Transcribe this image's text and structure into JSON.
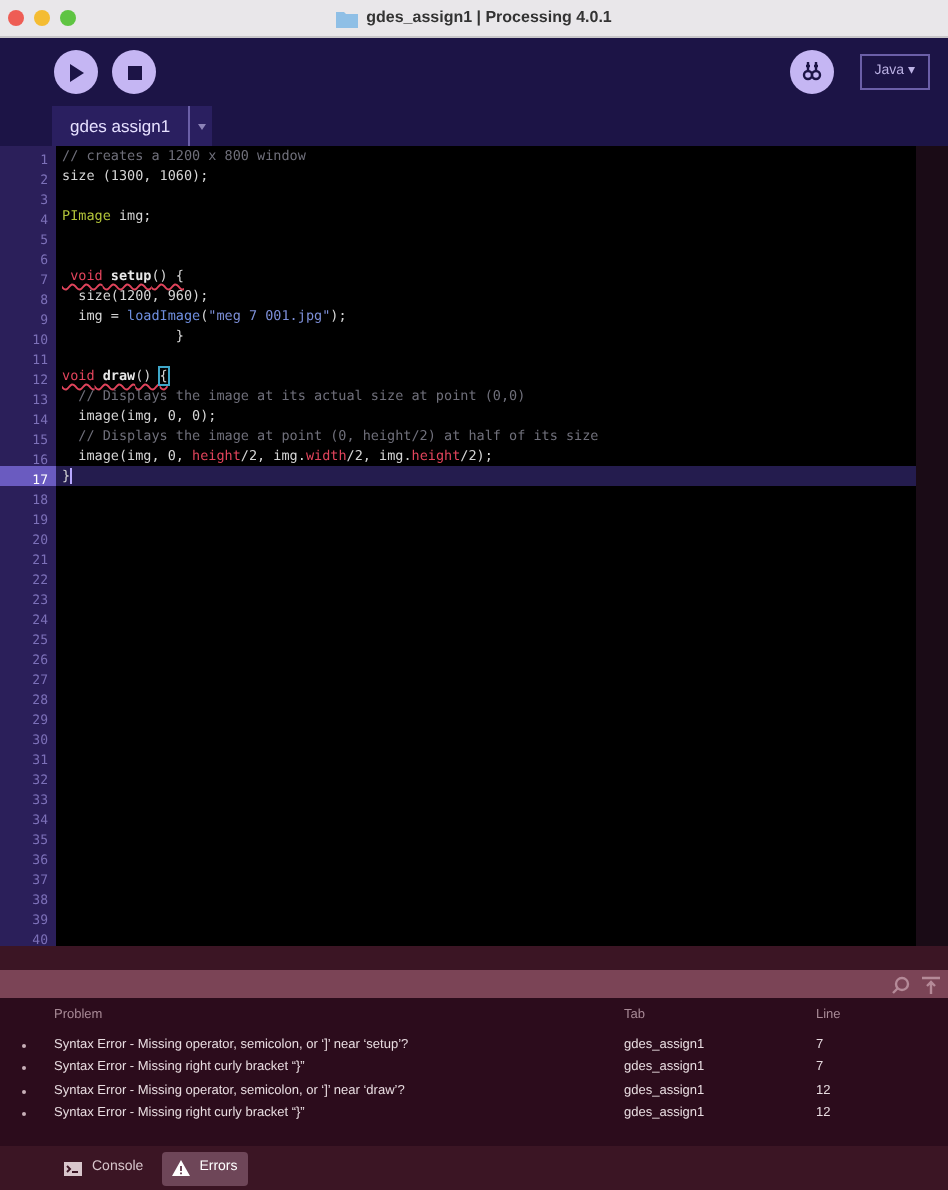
{
  "window": {
    "title": "gdes_assign1 | Processing 4.0.1"
  },
  "toolbar": {
    "mode": "Java ▾"
  },
  "tabs": [
    {
      "label": "gdes assign1",
      "selected": true
    }
  ],
  "editor": {
    "lines": [
      {
        "number": "1",
        "current": false,
        "tokens": [
          {
            "kind": "comment",
            "text": "// creates a 1200 x 800 window"
          }
        ]
      },
      {
        "number": "2",
        "current": false,
        "tokens": [
          {
            "kind": "plain",
            "text": "size (1300, 1060);"
          }
        ]
      },
      {
        "number": "3",
        "current": false
      },
      {
        "number": "4",
        "current": false,
        "tokens": [
          {
            "kind": "type",
            "text": "PImage"
          },
          {
            "kind": "plain",
            "text": " img;"
          }
        ]
      },
      {
        "number": "5",
        "current": false
      },
      {
        "number": "6",
        "current": false
      },
      {
        "number": "7",
        "current": false,
        "tokens": [
          {
            "kind": "keyword",
            "text": " void",
            "error": true
          },
          {
            "kind": "function",
            "text": " setup",
            "error": true
          },
          {
            "kind": "plain",
            "text": "() {",
            "error": true
          }
        ]
      },
      {
        "number": "8",
        "current": false,
        "tokens": [
          {
            "kind": "plain",
            "text": "  size(1200, 960);"
          }
        ]
      },
      {
        "number": "9",
        "current": false,
        "tokens": [
          {
            "kind": "plain",
            "text": "  img = "
          },
          {
            "kind": "builtin",
            "text": "loadImage"
          },
          {
            "kind": "plain",
            "text": "("
          },
          {
            "kind": "string",
            "text": "\"meg 7 001.jpg\""
          },
          {
            "kind": "plain",
            "text": ");"
          }
        ]
      },
      {
        "number": "10",
        "current": false,
        "tokens": [
          {
            "kind": "plain",
            "text": "              }"
          }
        ]
      },
      {
        "number": "11",
        "current": false
      },
      {
        "number": "12",
        "current": false,
        "tokens": [
          {
            "kind": "keyword",
            "text": "void",
            "error": true
          },
          {
            "kind": "function",
            "text": " draw",
            "error": true
          },
          {
            "kind": "plain",
            "text": "() ",
            "error": true
          },
          {
            "kind": "bracket",
            "text": "{",
            "error": true
          }
        ]
      },
      {
        "number": "13",
        "current": false,
        "tokens": [
          {
            "kind": "comment",
            "text": "  // Displays the image at its actual size at point (0,0)"
          }
        ]
      },
      {
        "number": "14",
        "current": false,
        "tokens": [
          {
            "kind": "plain",
            "text": "  image(img, 0, 0);"
          }
        ]
      },
      {
        "number": "15",
        "current": false,
        "tokens": [
          {
            "kind": "comment",
            "text": "  // Displays the image at point (0, height/2) at half of its size"
          }
        ]
      },
      {
        "number": "16",
        "current": false,
        "tokens": [
          {
            "kind": "plain",
            "text": "  image(img, 0, "
          },
          {
            "kind": "property",
            "text": "height"
          },
          {
            "kind": "plain",
            "text": "/2, img."
          },
          {
            "kind": "property",
            "text": "width"
          },
          {
            "kind": "plain",
            "text": "/2, img."
          },
          {
            "kind": "property",
            "text": "height"
          },
          {
            "kind": "plain",
            "text": "/2);"
          }
        ]
      },
      {
        "number": "17",
        "current": true,
        "tokens": [
          {
            "kind": "plain",
            "text": "}"
          }
        ]
      },
      {
        "number": "18",
        "current": false
      },
      {
        "number": "19",
        "current": false
      },
      {
        "number": "20",
        "current": false
      },
      {
        "number": "21",
        "current": false
      },
      {
        "number": "22",
        "current": false
      },
      {
        "number": "23",
        "current": false
      },
      {
        "number": "24",
        "current": false
      },
      {
        "number": "25",
        "current": false
      },
      {
        "number": "26",
        "current": false
      },
      {
        "number": "27",
        "current": false
      },
      {
        "number": "28",
        "current": false
      },
      {
        "number": "29",
        "current": false
      },
      {
        "number": "30",
        "current": false
      },
      {
        "number": "31",
        "current": false
      },
      {
        "number": "32",
        "current": false
      },
      {
        "number": "33",
        "current": false
      },
      {
        "number": "34",
        "current": false
      },
      {
        "number": "35",
        "current": false
      },
      {
        "number": "36",
        "current": false
      },
      {
        "number": "37",
        "current": false
      },
      {
        "number": "38",
        "current": false
      },
      {
        "number": "39",
        "current": false
      },
      {
        "number": "40",
        "current": false
      }
    ]
  },
  "problems": {
    "columns": [
      "Problem",
      "Tab",
      "Line"
    ],
    "rows": [
      {
        "problem": "Syntax Error - Missing operator, semicolon, or ‘]’ near ‘setup’?",
        "tab": "gdes_assign1",
        "line": "7"
      },
      {
        "problem": "Syntax Error - Missing right curly bracket “}”",
        "tab": "gdes_assign1",
        "line": "7"
      },
      {
        "problem": "Syntax Error - Missing operator, semicolon, or ‘]’ near ‘draw’?",
        "tab": "gdes_assign1",
        "line": "12"
      },
      {
        "problem": "Syntax Error - Missing right curly bracket “}”",
        "tab": "gdes_assign1",
        "line": "12"
      }
    ]
  },
  "bottom_tabs": [
    {
      "label": "Console",
      "kind": "console",
      "selected": false
    },
    {
      "label": "Errors",
      "kind": "errors",
      "selected": true
    }
  ]
}
